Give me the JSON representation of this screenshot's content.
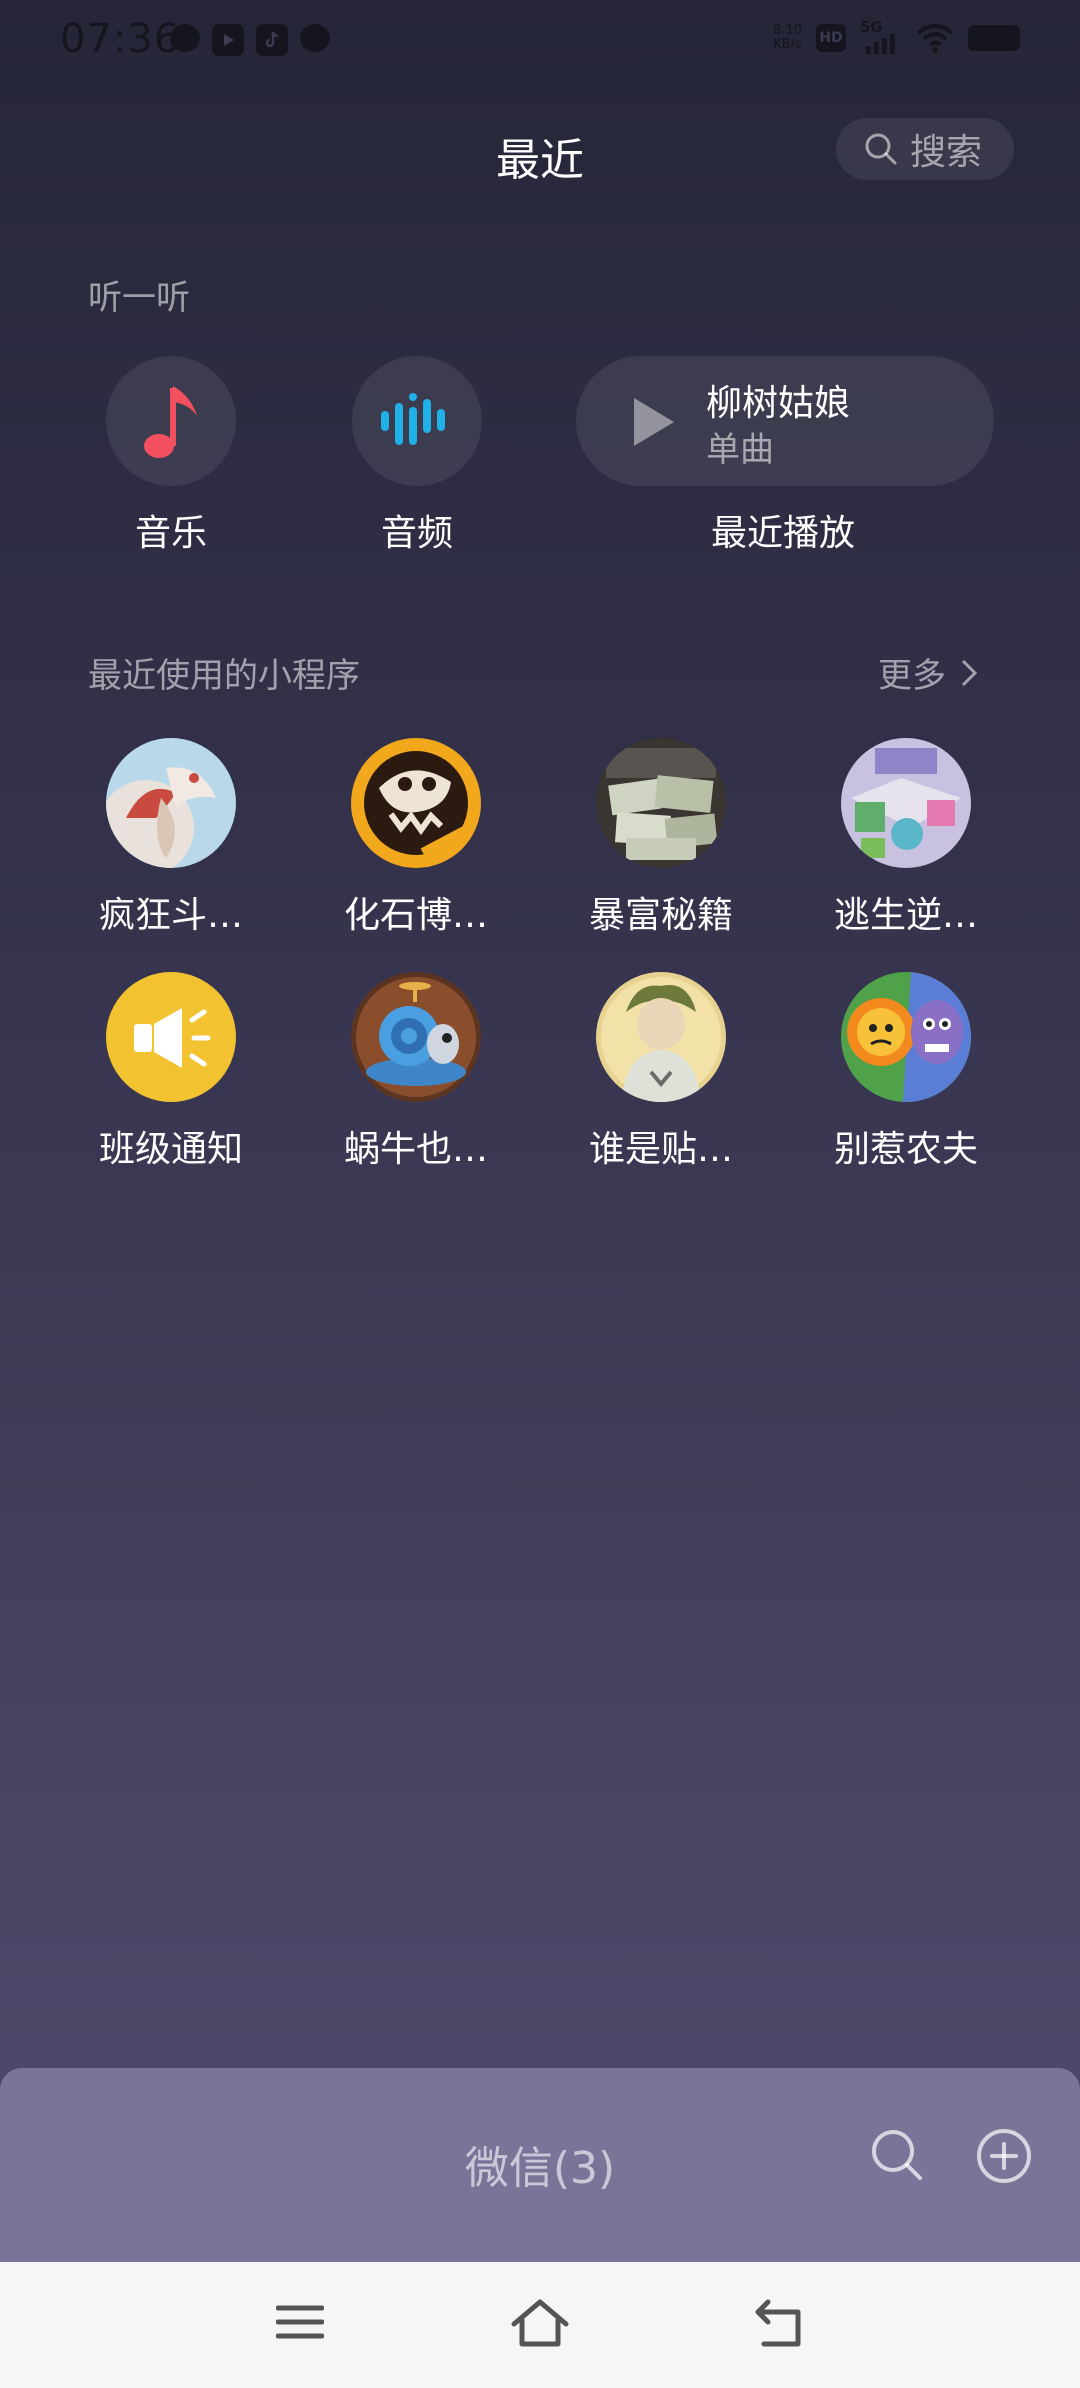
{
  "status_bar": {
    "time": "07:36",
    "net_speed_value": "8.10",
    "net_speed_unit": "KB/s",
    "hd": "HD",
    "network": "5G"
  },
  "header": {
    "title": "最近",
    "search_label": "搜索"
  },
  "listen": {
    "section_label": "听一听",
    "music_label": "音乐",
    "audio_label": "音频",
    "recent_label": "最近播放",
    "recent_song": "柳树姑娘",
    "recent_type": "单曲"
  },
  "mini_programs": {
    "section_label": "最近使用的小程序",
    "more_label": "更多",
    "items": [
      {
        "name": "疯狂斗…"
      },
      {
        "name": "化石博…"
      },
      {
        "name": "暴富秘籍"
      },
      {
        "name": "逃生逆…"
      },
      {
        "name": "班级通知"
      },
      {
        "name": "蜗牛也…"
      },
      {
        "name": "谁是贴…"
      },
      {
        "name": "别惹农夫"
      }
    ]
  },
  "wechat_bar": {
    "title": "微信(3)"
  },
  "colors": {
    "music_icon": "#f2505e",
    "audio_icon": "#1fb1e8",
    "notice_icon": "#f2c230",
    "wechat_bar": "#7b7498"
  }
}
